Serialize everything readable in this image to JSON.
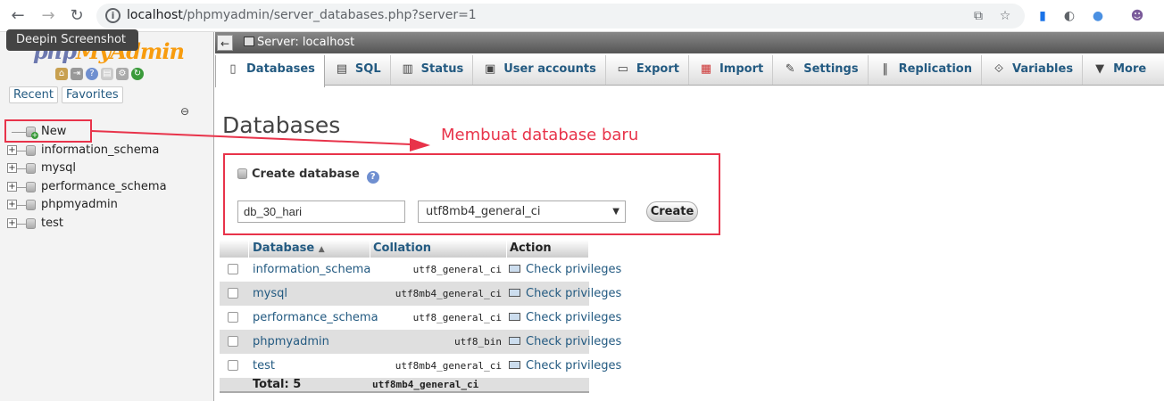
{
  "browser": {
    "url_host": "localhost",
    "url_path": "/phpmyadmin/server_databases.php?server=1"
  },
  "left": {
    "tooltip": "Deepin Screenshot",
    "logo_php": "php",
    "logo_rest": "MyAdmin",
    "recent_label": "Recent",
    "favorites_label": "Favorites",
    "tree": [
      {
        "label": "New"
      },
      {
        "label": "information_schema"
      },
      {
        "label": "mysql"
      },
      {
        "label": "performance_schema"
      },
      {
        "label": "phpmyadmin"
      },
      {
        "label": "test"
      }
    ]
  },
  "topbar": {
    "collapse": "←",
    "server": "Server: localhost"
  },
  "menu": [
    {
      "label": "Databases",
      "icon": "database-icon"
    },
    {
      "label": "SQL",
      "icon": "sql-icon"
    },
    {
      "label": "Status",
      "icon": "status-icon"
    },
    {
      "label": "User accounts",
      "icon": "users-icon"
    },
    {
      "label": "Export",
      "icon": "export-icon"
    },
    {
      "label": "Import",
      "icon": "import-icon"
    },
    {
      "label": "Settings",
      "icon": "settings-icon"
    },
    {
      "label": "Replication",
      "icon": "replication-icon"
    },
    {
      "label": "Variables",
      "icon": "variables-icon"
    },
    {
      "label": "More",
      "icon": "caret-down-icon"
    }
  ],
  "page_title": "Databases",
  "annotation": "Membuat database baru",
  "create": {
    "legend": "Create database",
    "name_value": "db_30_hari",
    "collation": "utf8mb4_general_ci",
    "button": "Create"
  },
  "table": {
    "headers": {
      "database": "Database",
      "collation": "Collation",
      "action": "Action"
    },
    "rows": [
      {
        "name": "information_schema",
        "collation": "utf8_general_ci",
        "action": "Check privileges"
      },
      {
        "name": "mysql",
        "collation": "utf8mb4_general_ci",
        "action": "Check privileges"
      },
      {
        "name": "performance_schema",
        "collation": "utf8_general_ci",
        "action": "Check privileges"
      },
      {
        "name": "phpmyadmin",
        "collation": "utf8_bin",
        "action": "Check privileges"
      },
      {
        "name": "test",
        "collation": "utf8mb4_general_ci",
        "action": "Check privileges"
      }
    ],
    "total_label": "Total: 5",
    "total_collation": "utf8mb4_general_ci"
  },
  "colors": {
    "annotation": "#e8334a",
    "link": "#235a81"
  }
}
